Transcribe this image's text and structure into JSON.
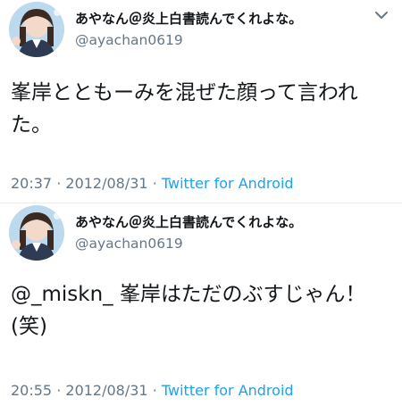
{
  "tweets": [
    {
      "display_name": "あやなん＠炎上白書読んでくれよな。",
      "handle": "@ayachan0619",
      "text": "峯岸とともーみを混ぜた顔って言われた。",
      "time": "20:37",
      "date": "2012/08/31",
      "separator": "·",
      "source": "Twitter for Android"
    },
    {
      "display_name": "あやなん＠炎上白書読んでくれよな。",
      "handle": "@ayachan0619",
      "text": "@_miskn_ 峯岸はただのぶすじゃん！(笑)",
      "time": "20:55",
      "date": "2012/08/31",
      "separator": "·",
      "source": "Twitter for Android"
    }
  ],
  "icons": {
    "more": "chevron-down-icon",
    "avatar": "avatar-photo"
  },
  "colors": {
    "text": "#14171a",
    "secondary": "#657786",
    "link": "#1da1f2",
    "divider": "#e6ecf0"
  }
}
